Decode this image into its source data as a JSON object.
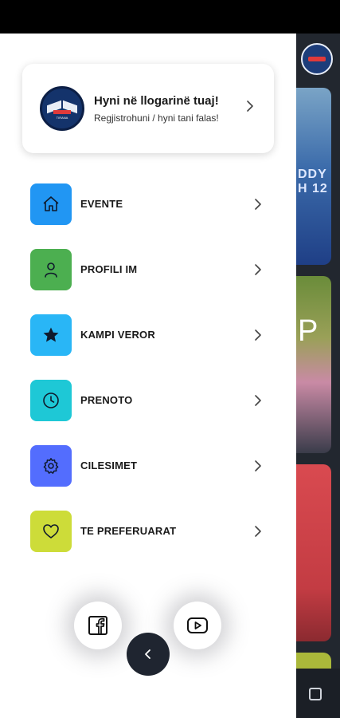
{
  "account": {
    "title": "Hyni në llogarinë tuaj!",
    "subtitle": "Regjistrohuni / hyni tani falas!"
  },
  "menu": {
    "items": [
      {
        "label": "EVENTE",
        "icon": "home-icon",
        "color": "#2196f3"
      },
      {
        "label": "PROFILI IM",
        "icon": "person-icon",
        "color": "#4caf50"
      },
      {
        "label": "KAMPI VEROR",
        "icon": "star-icon",
        "color": "#29b6f6"
      },
      {
        "label": "PRENOTO",
        "icon": "clock-icon",
        "color": "#1ec8d6"
      },
      {
        "label": "CILESIMET",
        "icon": "gear-icon",
        "color": "#536dfe"
      },
      {
        "label": "TE PREFERUARAT",
        "icon": "heart-icon",
        "color": "#cddc39"
      }
    ]
  },
  "social": {
    "facebook_icon": "facebook-icon",
    "youtube_icon": "youtube-icon"
  },
  "background": {
    "jersey_text": "DDY\nH 12",
    "letter": "P"
  }
}
